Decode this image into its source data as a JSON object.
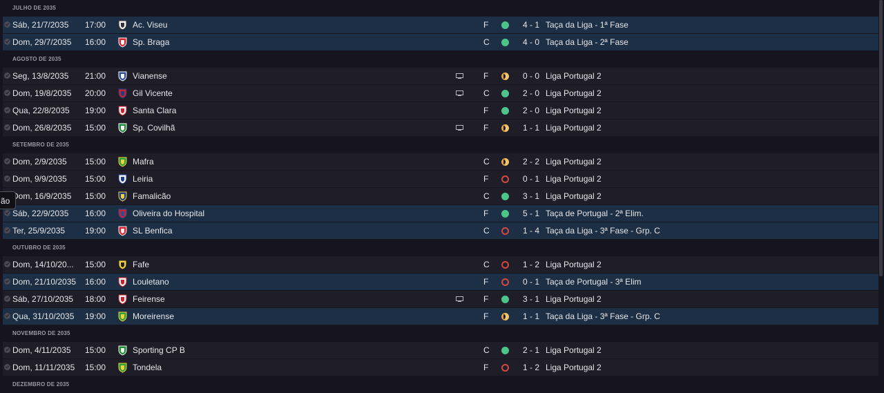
{
  "tooltip": "ão",
  "months": [
    {
      "label": "JULHO DE 2035",
      "matches": [
        {
          "date": "Sáb, 21/7/2035",
          "time": "17:00",
          "opponent": "Ac. Viseu",
          "crest": "ac-viseu-crest",
          "tv": false,
          "venue": "F",
          "result": "W",
          "score": "4 - 1",
          "competition": "Taça da Liga - 1ª Fase",
          "highlight": true
        },
        {
          "date": "Dom, 29/7/2035",
          "time": "16:00",
          "opponent": "Sp. Braga",
          "crest": "sp-braga-crest",
          "tv": false,
          "venue": "C",
          "result": "W",
          "score": "4 - 0",
          "competition": "Taça da Liga - 2ª Fase",
          "highlight": true
        }
      ]
    },
    {
      "label": "AGOSTO DE 2035",
      "matches": [
        {
          "date": "Seg, 13/8/2035",
          "time": "21:00",
          "opponent": "Vianense",
          "crest": "vianense-crest",
          "tv": true,
          "venue": "F",
          "result": "D",
          "score": "0 - 0",
          "competition": "Liga Portugal 2",
          "highlight": false
        },
        {
          "date": "Dom, 19/8/2035",
          "time": "20:00",
          "opponent": "Gil Vicente",
          "crest": "gil-vicente-crest",
          "tv": true,
          "venue": "C",
          "result": "W",
          "score": "2 - 0",
          "competition": "Liga Portugal 2",
          "highlight": false
        },
        {
          "date": "Qua, 22/8/2035",
          "time": "19:00",
          "opponent": "Santa Clara",
          "crest": "santa-clara-crest",
          "tv": false,
          "venue": "F",
          "result": "W",
          "score": "2 - 0",
          "competition": "Liga Portugal 2",
          "highlight": false
        },
        {
          "date": "Dom, 26/8/2035",
          "time": "15:00",
          "opponent": "Sp. Covilhã",
          "crest": "sp-covilha-crest",
          "tv": true,
          "venue": "F",
          "result": "D",
          "score": "1 - 1",
          "competition": "Liga Portugal 2",
          "highlight": false
        }
      ]
    },
    {
      "label": "SETEMBRO DE 2035",
      "matches": [
        {
          "date": "Dom, 2/9/2035",
          "time": "15:00",
          "opponent": "Mafra",
          "crest": "mafra-crest",
          "tv": false,
          "venue": "C",
          "result": "D",
          "score": "2 - 2",
          "competition": "Liga Portugal 2",
          "highlight": false
        },
        {
          "date": "Dom, 9/9/2035",
          "time": "15:00",
          "opponent": "Leiria",
          "crest": "leiria-crest",
          "tv": false,
          "venue": "F",
          "result": "L",
          "score": "0 - 1",
          "competition": "Liga Portugal 2",
          "highlight": false
        },
        {
          "date": "Dom, 16/9/2035",
          "time": "15:00",
          "opponent": "Famalicão",
          "crest": "famalicao-crest",
          "tv": false,
          "venue": "C",
          "result": "W",
          "score": "3 - 1",
          "competition": "Liga Portugal 2",
          "highlight": false
        },
        {
          "date": "Sáb, 22/9/2035",
          "time": "16:00",
          "opponent": "Oliveira do Hospital",
          "crest": "oliveira-crest",
          "tv": false,
          "venue": "F",
          "result": "W",
          "score": "5 - 1",
          "competition": "Taça de Portugal - 2ª Elim.",
          "highlight": true
        },
        {
          "date": "Ter, 25/9/2035",
          "time": "19:00",
          "opponent": "SL Benfica",
          "crest": "sl-benfica-crest",
          "tv": false,
          "venue": "C",
          "result": "L",
          "score": "1 - 4",
          "competition": "Taça da Liga - 3ª Fase - Grp. C",
          "highlight": true
        }
      ]
    },
    {
      "label": "OUTUBRO DE 2035",
      "matches": [
        {
          "date": "Dom, 14/10/20...",
          "time": "15:00",
          "opponent": "Fafe",
          "crest": "fafe-crest",
          "tv": false,
          "venue": "C",
          "result": "L",
          "score": "1 - 2",
          "competition": "Liga Portugal 2",
          "highlight": false
        },
        {
          "date": "Dom, 21/10/2035",
          "time": "16:00",
          "opponent": "Louletano",
          "crest": "louletano-crest",
          "tv": false,
          "venue": "F",
          "result": "L",
          "score": "0 - 1",
          "competition": "Taça de Portugal - 3ª Elim",
          "highlight": true
        },
        {
          "date": "Sáb, 27/10/2035",
          "time": "18:00",
          "opponent": "Feirense",
          "crest": "feirense-crest",
          "tv": true,
          "venue": "F",
          "result": "W",
          "score": "3 - 1",
          "competition": "Liga Portugal 2",
          "highlight": false
        },
        {
          "date": "Qua, 31/10/2035",
          "time": "19:00",
          "opponent": "Moreirense",
          "crest": "moreirense-crest",
          "tv": false,
          "venue": "F",
          "result": "D",
          "score": "1 - 1",
          "competition": "Taça da Liga - 3ª Fase - Grp. C",
          "highlight": true
        }
      ]
    },
    {
      "label": "NOVEMBRO DE 2035",
      "matches": [
        {
          "date": "Dom, 4/11/2035",
          "time": "15:00",
          "opponent": "Sporting CP B",
          "crest": "sporting-crest",
          "tv": false,
          "venue": "C",
          "result": "W",
          "score": "2 - 1",
          "competition": "Liga Portugal 2",
          "highlight": false
        },
        {
          "date": "Dom, 11/11/2035",
          "time": "15:00",
          "opponent": "Tondela",
          "crest": "tondela-crest",
          "tv": false,
          "venue": "F",
          "result": "L",
          "score": "1 - 2",
          "competition": "Liga Portugal 2",
          "highlight": false
        }
      ]
    },
    {
      "label": "DEZEMBRO DE 2035",
      "matches": []
    }
  ],
  "colors": {
    "win": "#4dc48a",
    "loss": "#d4483f",
    "draw": "#e8a33a",
    "row": "#1e1d28",
    "row_highlight": "#1d2f45"
  }
}
